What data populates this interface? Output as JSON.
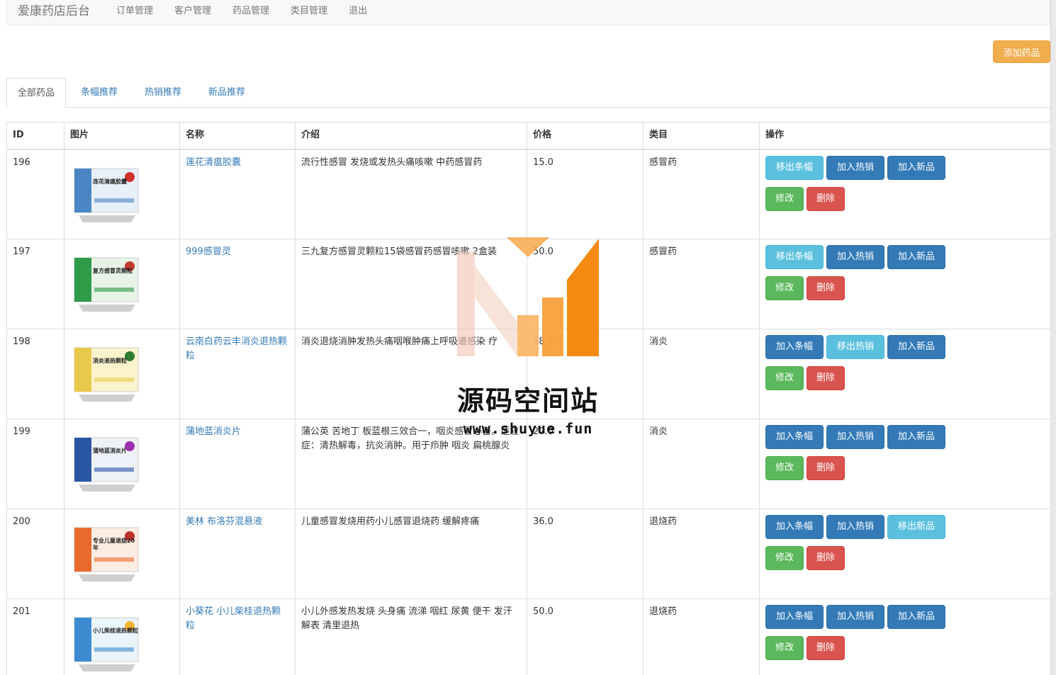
{
  "navbar": {
    "brand": "爱康药店后台",
    "links": [
      "订单管理",
      "客户管理",
      "药品管理",
      "类目管理",
      "退出"
    ]
  },
  "add_button": "添加药品",
  "tabs": [
    "全部药品",
    "条幅推荐",
    "热销推荐",
    "新品推荐"
  ],
  "table": {
    "headers": [
      "ID",
      "图片",
      "名称",
      "介绍",
      "价格",
      "类目",
      "操作"
    ],
    "rows": [
      {
        "id": "196",
        "name": "莲花清瘟胶囊",
        "intro": "流行性感冒 发烧或发热头痛咳嗽 中药感冒药",
        "price": "15.0",
        "category": "感冒药",
        "banner_btn": "移出条幅",
        "hot_btn": "加入热销",
        "new_btn": "加入新品",
        "image_label": "连花清瘟胶囊"
      },
      {
        "id": "197",
        "name": "999感冒灵",
        "intro": "三九复方感冒灵颗粒15袋感冒药感冒咳嗽 2盒装",
        "price": "50.0",
        "category": "感冒药",
        "banner_btn": "移出条幅",
        "hot_btn": "加入热销",
        "new_btn": "加入新品",
        "image_label": "复方感冒灵颗粒"
      },
      {
        "id": "198",
        "name": "云南白药云丰消炎退热颗粒",
        "intro": "消炎退烧消肿发热头痛咽喉肿痛上呼吸道感染 疗",
        "price": "38.0",
        "category": "消炎",
        "banner_btn": "加入条幅",
        "hot_btn": "移出热销",
        "new_btn": "加入新品",
        "image_label": "消炎退热颗粒"
      },
      {
        "id": "199",
        "name": "蒲地蓝消炎片",
        "intro": "蒲公英 苦地丁 板蓝根三效合一，咽炎感冒必备。适应症：清热解毒，抗炎消肿。用于疖肿 咽炎 扁桃腺炎",
        "price": "20.0",
        "category": "消炎",
        "banner_btn": "加入条幅",
        "hot_btn": "加入热销",
        "new_btn": "加入新品",
        "image_label": "蒲地蓝消炎片"
      },
      {
        "id": "200",
        "name": "美林 布洛芬混悬液",
        "intro": "儿童感冒发烧用药小儿感冒退烧药 缓解疼痛",
        "price": "36.0",
        "category": "退烧药",
        "banner_btn": "加入条幅",
        "hot_btn": "加入热销",
        "new_btn": "移出新品",
        "image_label": "专业儿童退烧20年"
      },
      {
        "id": "201",
        "name": "小葵花 小儿柴桂退热颗粒",
        "intro": "小儿外感发热发烧 头身痛 流涕 咽红 尿黄 便干 发汗解表 清里退热",
        "price": "50.0",
        "category": "退烧药",
        "banner_btn": "加入条幅",
        "hot_btn": "加入热销",
        "new_btn": "加入新品",
        "image_label": "小儿柴桂退热颗粒"
      }
    ],
    "edit_label": "修改",
    "delete_label": "删除"
  },
  "watermark": {
    "title": "源码空间站",
    "url": "www.shuyue.fun"
  }
}
